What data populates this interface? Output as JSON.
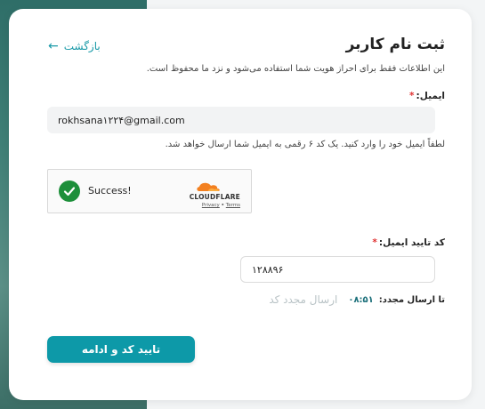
{
  "header": {
    "back_label": "بازگشت",
    "title": "ثبت نام کاربر",
    "subtitle": "این اطلاعات فقط برای احراز هویت شما استفاده می‌شود و نزد ما محفوظ است."
  },
  "email_field": {
    "label": "ایمیل:",
    "required_mark": "*",
    "value": "rokhsana۱۲۲۴@gmail.com",
    "hint": "لطفاً ایمیل خود را وارد کنید. یک کد ۶ رقمی به ایمیل شما ارسال خواهد شد."
  },
  "captcha": {
    "status": "Success!",
    "brand": "CLOUDFLARE",
    "privacy_label": "Privacy",
    "separator": "•",
    "terms_label": "Terms",
    "check_color": "#1d8f3a",
    "brand_color": "#f38020"
  },
  "code_field": {
    "label": "کد تایید ایمیل:",
    "required_mark": "*",
    "value": "۱۲۸۸۹۶"
  },
  "resend": {
    "label": "تا ارسال مجدد:",
    "timer": "۰۸:۵۱",
    "link_label": "ارسال مجدد کد"
  },
  "submit": {
    "label": "تایید کد و ادامه",
    "color": "#0d99a8"
  }
}
